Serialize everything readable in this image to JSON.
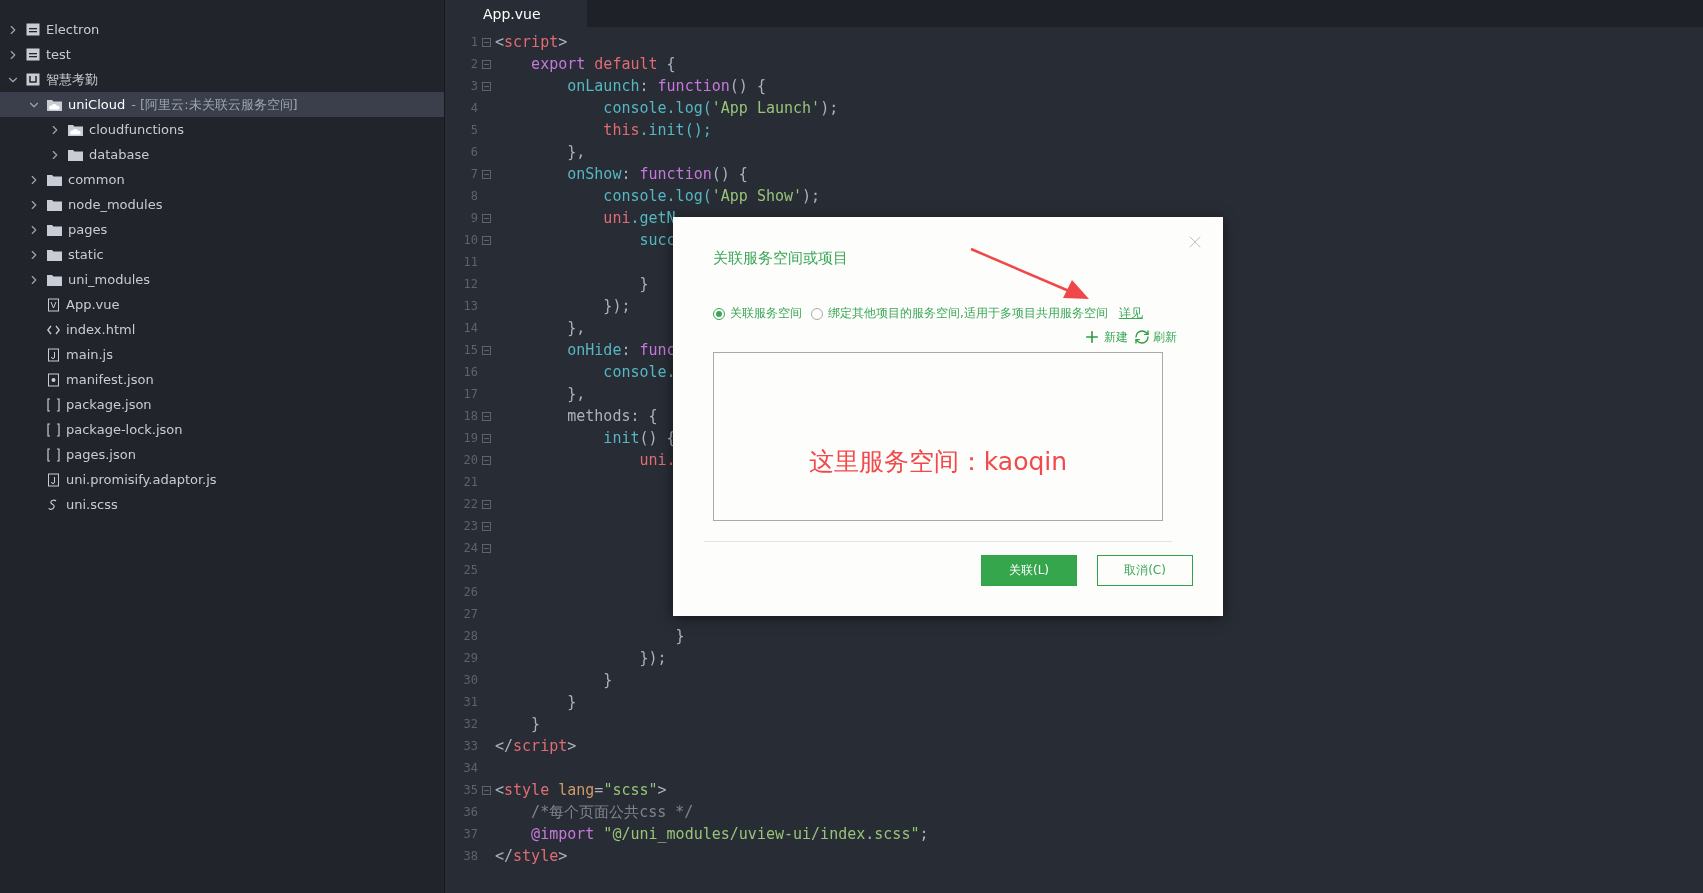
{
  "sidebar": {
    "items": [
      {
        "label": "Electron",
        "kind": "project",
        "expanded": false,
        "selected": false
      },
      {
        "label": "test",
        "kind": "project",
        "expanded": false,
        "selected": false
      },
      {
        "label": "智慧考勤",
        "kind": "uni-project",
        "expanded": true,
        "selected": false,
        "children": [
          {
            "label": "uniCloud",
            "suffix": "- [阿里云:未关联云服务空间]",
            "kind": "cloud-folder",
            "expanded": true,
            "selected": true,
            "children": [
              {
                "label": "cloudfunctions",
                "kind": "cloud-folder",
                "expanded": false,
                "selected": false
              },
              {
                "label": "database",
                "kind": "folder",
                "expanded": false,
                "selected": false
              }
            ]
          },
          {
            "label": "common",
            "kind": "folder",
            "expanded": false,
            "selected": false
          },
          {
            "label": "node_modules",
            "kind": "folder",
            "expanded": false,
            "selected": false
          },
          {
            "label": "pages",
            "kind": "folder",
            "expanded": false,
            "selected": false
          },
          {
            "label": "static",
            "kind": "folder",
            "expanded": false,
            "selected": false
          },
          {
            "label": "uni_modules",
            "kind": "folder",
            "expanded": false,
            "selected": false
          },
          {
            "label": "App.vue",
            "kind": "vue",
            "selected": false
          },
          {
            "label": "index.html",
            "kind": "html",
            "selected": false
          },
          {
            "label": "main.js",
            "kind": "js",
            "selected": false
          },
          {
            "label": "manifest.json",
            "kind": "config",
            "selected": false
          },
          {
            "label": "package.json",
            "kind": "json",
            "selected": false
          },
          {
            "label": "package-lock.json",
            "kind": "json",
            "selected": false
          },
          {
            "label": "pages.json",
            "kind": "json",
            "selected": false
          },
          {
            "label": "uni.promisify.adaptor.js",
            "kind": "js",
            "selected": false
          },
          {
            "label": "uni.scss",
            "kind": "scss",
            "selected": false
          }
        ]
      }
    ]
  },
  "tabs": [
    {
      "label": "App.vue",
      "selected": true
    }
  ],
  "editor": {
    "lines": [
      {
        "n": "1",
        "fold": true,
        "tokens": [
          {
            "text": "<",
            "kind": "punct"
          },
          {
            "text": "script",
            "kind": "tag"
          },
          {
            "text": ">",
            "kind": "punct"
          }
        ]
      },
      {
        "n": "2",
        "fold": true,
        "tokens": [
          {
            "text": "    export",
            "kind": "keyword"
          },
          {
            "text": " default",
            "kind": "red"
          },
          {
            "text": " {",
            "kind": "punct"
          }
        ]
      },
      {
        "n": "3",
        "fold": true,
        "tokens": [
          {
            "text": "        onLaunch",
            "kind": "func"
          },
          {
            "text": ":",
            "kind": "punct"
          },
          {
            "text": " function",
            "kind": "keyword"
          },
          {
            "text": "() {",
            "kind": "punct"
          }
        ]
      },
      {
        "n": "4",
        "fold": false,
        "tokens": [
          {
            "text": "            console.log(",
            "kind": "func"
          },
          {
            "text": "'App Launch'",
            "kind": "string"
          },
          {
            "text": ");",
            "kind": "punct"
          }
        ]
      },
      {
        "n": "5",
        "fold": false,
        "tokens": [
          {
            "text": "            this",
            "kind": "red"
          },
          {
            "text": ".init();",
            "kind": "func"
          }
        ]
      },
      {
        "n": "6",
        "fold": false,
        "tokens": [
          {
            "text": "        },",
            "kind": "punct"
          }
        ]
      },
      {
        "n": "7",
        "fold": true,
        "tokens": [
          {
            "text": "        onShow",
            "kind": "func"
          },
          {
            "text": ":",
            "kind": "punct"
          },
          {
            "text": " function",
            "kind": "keyword"
          },
          {
            "text": "() {",
            "kind": "punct"
          }
        ]
      },
      {
        "n": "8",
        "fold": false,
        "tokens": [
          {
            "text": "            console.log(",
            "kind": "func"
          },
          {
            "text": "'App Show'",
            "kind": "string"
          },
          {
            "text": ");",
            "kind": "punct"
          }
        ]
      },
      {
        "n": "9",
        "fold": true,
        "tokens": [
          {
            "text": "            uni",
            "kind": "red"
          },
          {
            "text": ".getN",
            "kind": "func"
          }
        ]
      },
      {
        "n": "10",
        "fold": true,
        "tokens": [
          {
            "text": "                succ",
            "kind": "func"
          }
        ]
      },
      {
        "n": "11",
        "fold": false
      },
      {
        "n": "12",
        "fold": false,
        "tokens": [
          {
            "text": "                }",
            "kind": "punct"
          }
        ]
      },
      {
        "n": "13",
        "fold": false,
        "tokens": [
          {
            "text": "            });",
            "kind": "punct"
          }
        ]
      },
      {
        "n": "14",
        "fold": false,
        "tokens": [
          {
            "text": "        },",
            "kind": "punct"
          }
        ]
      },
      {
        "n": "15",
        "fold": true,
        "tokens": [
          {
            "text": "        onHide",
            "kind": "func"
          },
          {
            "text": ":",
            "kind": "punct"
          },
          {
            "text": " func",
            "kind": "keyword"
          }
        ]
      },
      {
        "n": "16",
        "fold": false,
        "tokens": [
          {
            "text": "            console.",
            "kind": "func"
          }
        ]
      },
      {
        "n": "17",
        "fold": false,
        "tokens": [
          {
            "text": "        },",
            "kind": "punct"
          }
        ]
      },
      {
        "n": "18",
        "fold": true,
        "tokens": [
          {
            "text": "        methods",
            "kind": "plain"
          },
          {
            "text": ": {",
            "kind": "punct"
          }
        ]
      },
      {
        "n": "19",
        "fold": true,
        "tokens": [
          {
            "text": "            init",
            "kind": "func"
          },
          {
            "text": "() {",
            "kind": "punct"
          }
        ]
      },
      {
        "n": "20",
        "fold": true,
        "tokens": [
          {
            "text": "                uni.",
            "kind": "red"
          }
        ]
      },
      {
        "n": "21",
        "fold": false
      },
      {
        "n": "22",
        "fold": true
      },
      {
        "n": "23",
        "fold": true
      },
      {
        "n": "24",
        "fold": true
      },
      {
        "n": "25",
        "fold": false
      },
      {
        "n": "26",
        "fold": false
      },
      {
        "n": "27",
        "fold": false
      },
      {
        "n": "28",
        "fold": false,
        "tokens": [
          {
            "text": "                    }",
            "kind": "punct"
          }
        ]
      },
      {
        "n": "29",
        "fold": false,
        "tokens": [
          {
            "text": "                });",
            "kind": "punct"
          }
        ]
      },
      {
        "n": "30",
        "fold": false,
        "tokens": [
          {
            "text": "            }",
            "kind": "punct"
          }
        ]
      },
      {
        "n": "31",
        "fold": false,
        "tokens": [
          {
            "text": "        }",
            "kind": "punct"
          }
        ]
      },
      {
        "n": "32",
        "fold": false,
        "tokens": [
          {
            "text": "    }",
            "kind": "punct"
          }
        ]
      },
      {
        "n": "33",
        "fold": false,
        "tokens": [
          {
            "text": "</",
            "kind": "punct"
          },
          {
            "text": "script",
            "kind": "tag"
          },
          {
            "text": ">",
            "kind": "punct"
          }
        ]
      },
      {
        "n": "34",
        "fold": false
      },
      {
        "n": "35",
        "fold": true,
        "tokens": [
          {
            "text": "<",
            "kind": "punct"
          },
          {
            "text": "style",
            "kind": "tag"
          },
          {
            "text": " lang",
            "kind": "attr"
          },
          {
            "text": "=",
            "kind": "punct"
          },
          {
            "text": "\"scss\"",
            "kind": "string"
          },
          {
            "text": ">",
            "kind": "punct"
          }
        ]
      },
      {
        "n": "36",
        "fold": false,
        "tokens": [
          {
            "text": "    /*每个页面公共css */",
            "kind": "comment"
          }
        ]
      },
      {
        "n": "37",
        "fold": false,
        "tokens": [
          {
            "text": "    @import",
            "kind": "keyword"
          },
          {
            "text": " \"@/uni_modules/uview-ui/index.scss\"",
            "kind": "string"
          },
          {
            "text": ";",
            "kind": "punct"
          }
        ]
      },
      {
        "n": "38",
        "fold": false,
        "tokens": [
          {
            "text": "</",
            "kind": "punct"
          },
          {
            "text": "style",
            "kind": "tag"
          },
          {
            "text": ">",
            "kind": "punct"
          }
        ]
      }
    ]
  },
  "dialog": {
    "title": "关联服务空间或项目",
    "options": [
      {
        "label": "关联服务空间",
        "selected": true
      },
      {
        "label": "绑定其他项目的服务空间,适用于多项目共用服务空间",
        "selected": false
      }
    ],
    "link": "详见",
    "actions": [
      {
        "label": "新建",
        "kind": "add"
      },
      {
        "label": "刷新",
        "kind": "refresh"
      }
    ],
    "annotation": "这里服务空间：kaoqin",
    "buttons": [
      {
        "label": "关联(L)",
        "kind": "primary"
      },
      {
        "label": "取消(C)",
        "kind": "secondary"
      }
    ]
  }
}
